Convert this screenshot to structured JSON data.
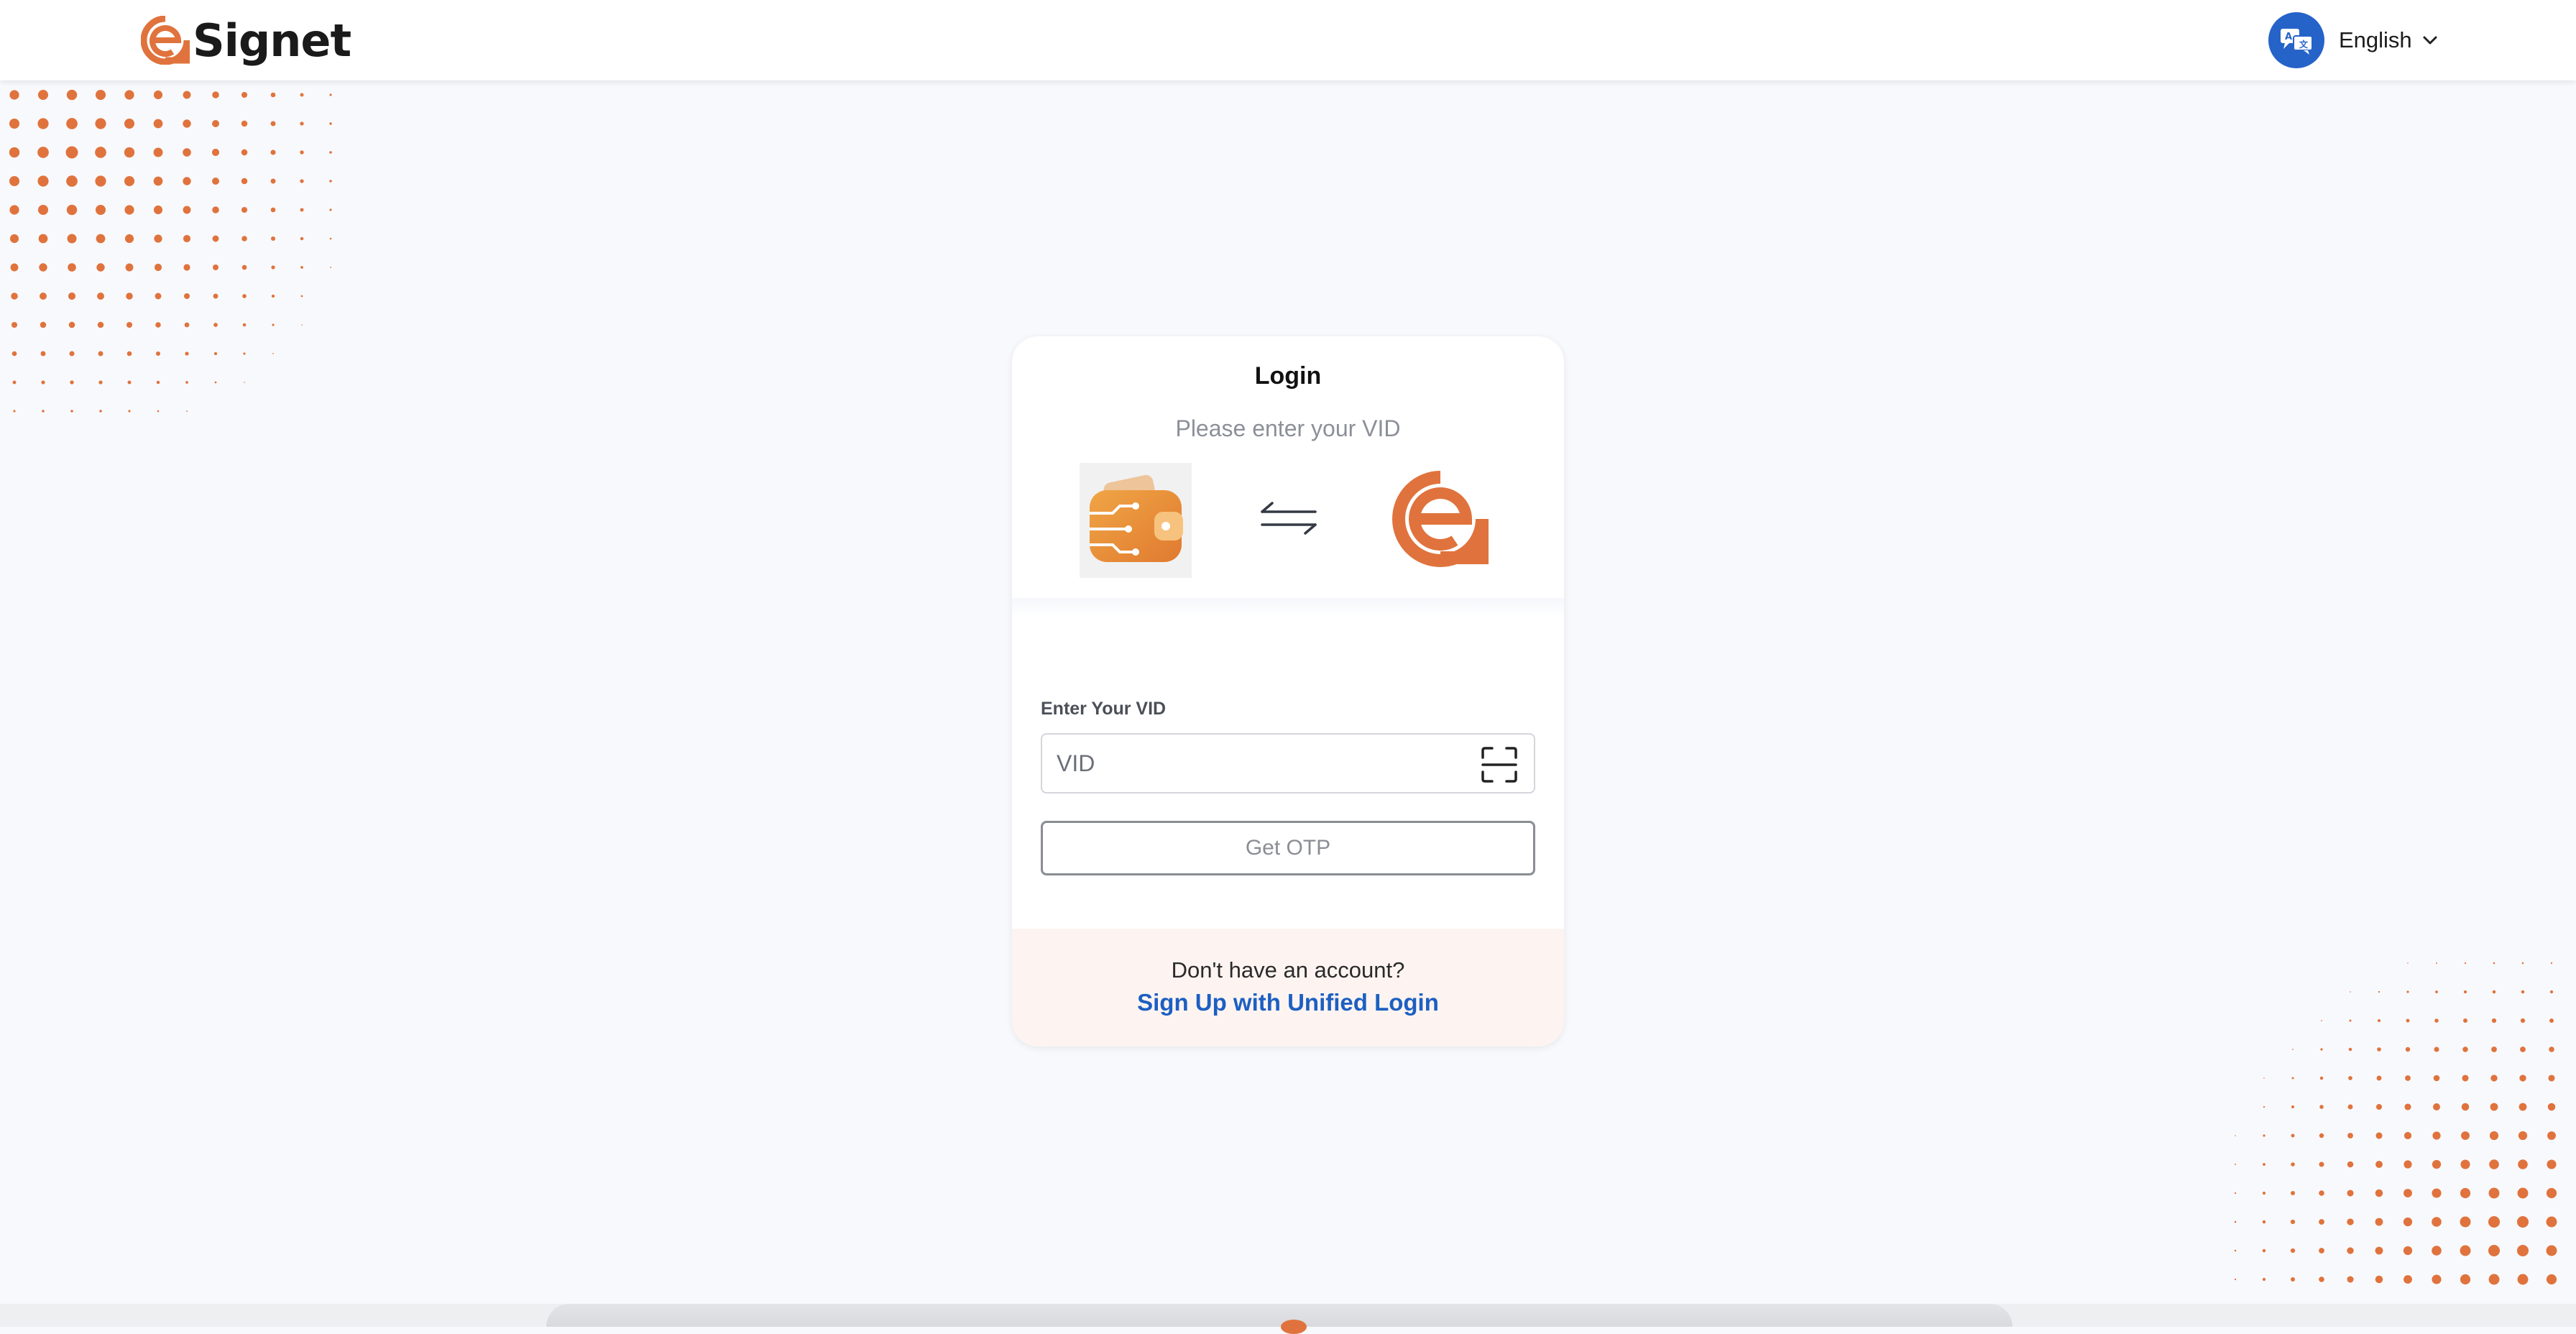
{
  "header": {
    "brand_name": "Signet",
    "brand_icon": "signet-e-logo",
    "language": {
      "icon": "language-translate-icon",
      "label": "English",
      "chevron": "chevron-down-icon"
    }
  },
  "login_card": {
    "title": "Login",
    "subtitle": "Please enter your VID",
    "wallet_logo": "wallet-circuit-logo",
    "swap_icon": "swap-arrows-icon",
    "partner_logo": "signet-e-logo",
    "vid_field": {
      "label": "Enter Your VID",
      "placeholder": "VID",
      "value": "",
      "scan_icon": "qr-scan-icon"
    },
    "otp_button_label": "Get OTP",
    "footer": {
      "question": "Don't have an account?",
      "signup_link": "Sign Up with Unified Login"
    }
  },
  "colors": {
    "brand_orange": "#e0733d",
    "link_blue": "#1d5fc2",
    "language_badge": "#2563c9",
    "page_background": "#f8f9fc",
    "footer_band": "#fdf4f1"
  }
}
